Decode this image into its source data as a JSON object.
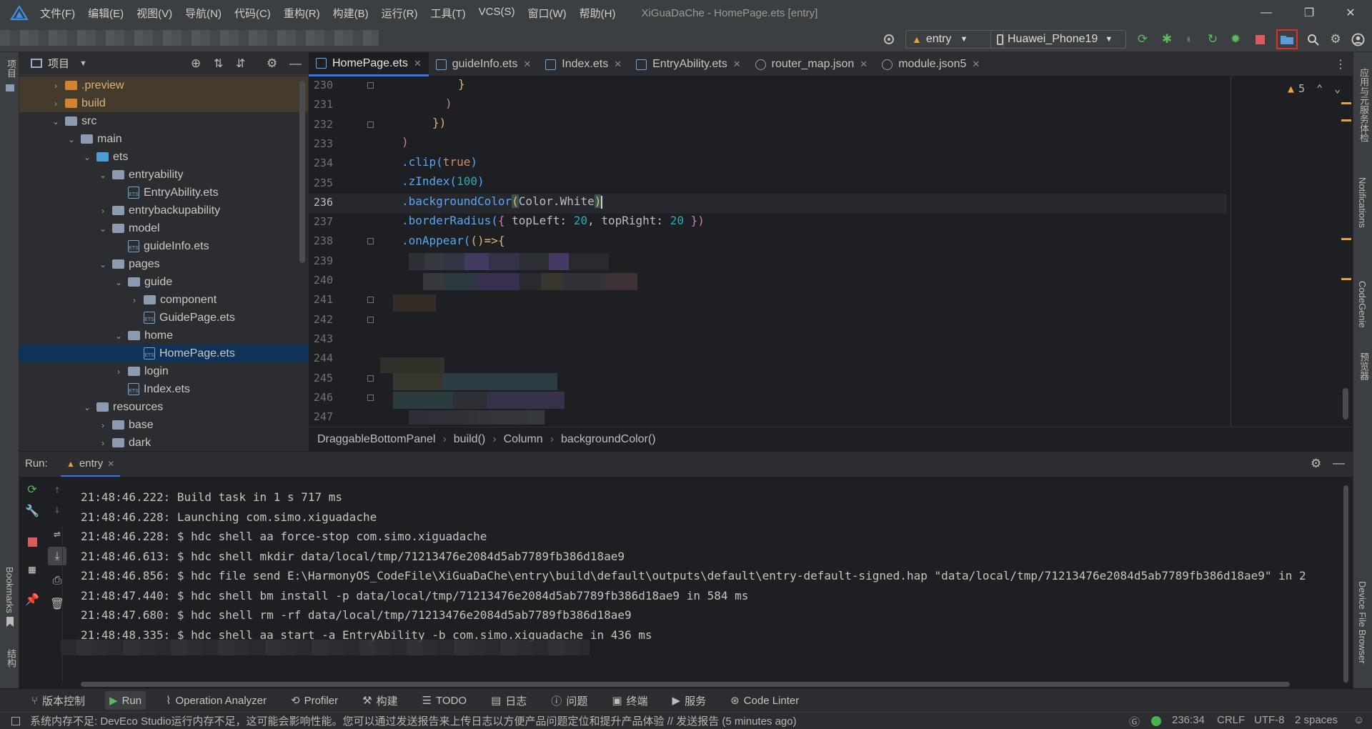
{
  "titlebar": {
    "menus": [
      "文件(F)",
      "编辑(E)",
      "视图(V)",
      "导航(N)",
      "代码(C)",
      "重构(R)",
      "构建(B)",
      "运行(R)",
      "工具(T)",
      "VCS(S)",
      "窗口(W)",
      "帮助(H)"
    ],
    "title": "XiGuaDaChe - HomePage.ets [entry]"
  },
  "toolbar": {
    "module": "entry",
    "device": "Huawei_Phone19"
  },
  "left_strip": {
    "project_label": "项目",
    "bookmarks_label": "Bookmarks",
    "structure_label": "结构"
  },
  "right_strip": {
    "item1": "应用与元服务体检",
    "item2": "Notifications",
    "item3": "CodeGenie",
    "item4": "预览器",
    "item5": "Device File Browser"
  },
  "project": {
    "title": "项目",
    "tree": [
      {
        "label": ".preview",
        "indent": 1,
        "chev": "›",
        "kind": "folder-orange",
        "excluded": true
      },
      {
        "label": "build",
        "indent": 1,
        "chev": "›",
        "kind": "folder-orange",
        "excluded": true
      },
      {
        "label": "src",
        "indent": 1,
        "chev": "⌄",
        "kind": "folder"
      },
      {
        "label": "main",
        "indent": 2,
        "chev": "⌄",
        "kind": "folder"
      },
      {
        "label": "ets",
        "indent": 3,
        "chev": "⌄",
        "kind": "folder-blue"
      },
      {
        "label": "entryability",
        "indent": 4,
        "chev": "⌄",
        "kind": "folder"
      },
      {
        "label": "EntryAbility.ets",
        "indent": 5,
        "chev": "",
        "kind": "file"
      },
      {
        "label": "entrybackupability",
        "indent": 4,
        "chev": "›",
        "kind": "folder"
      },
      {
        "label": "model",
        "indent": 4,
        "chev": "⌄",
        "kind": "folder"
      },
      {
        "label": "guideInfo.ets",
        "indent": 5,
        "chev": "",
        "kind": "file"
      },
      {
        "label": "pages",
        "indent": 4,
        "chev": "⌄",
        "kind": "folder"
      },
      {
        "label": "guide",
        "indent": 5,
        "chev": "⌄",
        "kind": "folder"
      },
      {
        "label": "component",
        "indent": 6,
        "chev": "›",
        "kind": "folder"
      },
      {
        "label": "GuidePage.ets",
        "indent": 6,
        "chev": "",
        "kind": "file"
      },
      {
        "label": "home",
        "indent": 5,
        "chev": "⌄",
        "kind": "folder"
      },
      {
        "label": "HomePage.ets",
        "indent": 6,
        "chev": "",
        "kind": "file",
        "selected": true
      },
      {
        "label": "login",
        "indent": 5,
        "chev": "›",
        "kind": "folder"
      },
      {
        "label": "Index.ets",
        "indent": 5,
        "chev": "",
        "kind": "file"
      },
      {
        "label": "resources",
        "indent": 3,
        "chev": "⌄",
        "kind": "folder"
      },
      {
        "label": "base",
        "indent": 4,
        "chev": "›",
        "kind": "folder"
      },
      {
        "label": "dark",
        "indent": 4,
        "chev": "›",
        "kind": "folder"
      }
    ]
  },
  "tabs": [
    {
      "label": "HomePage.ets",
      "active": true,
      "icon": "ets"
    },
    {
      "label": "guideInfo.ets",
      "icon": "ets"
    },
    {
      "label": "Index.ets",
      "icon": "ets"
    },
    {
      "label": "EntryAbility.ets",
      "icon": "ets"
    },
    {
      "label": "router_map.json",
      "icon": "json"
    },
    {
      "label": "module.json5",
      "icon": "json"
    }
  ],
  "editor": {
    "warnings": "5",
    "line_numbers": [
      "230",
      "231",
      "232",
      "233",
      "234",
      "235",
      "236",
      "237",
      "238",
      "239",
      "240",
      "241",
      "242",
      "243",
      "244",
      "245",
      "246",
      "247"
    ],
    "code": {
      "l230": "}",
      "l231": ")",
      "l232": "})",
      "l233": ")",
      "l234_a": ".clip(",
      "l234_b": "true",
      "l234_c": ")",
      "l235_a": ".zIndex(",
      "l235_b": "100",
      "l235_c": ")",
      "l236_a": ".backgroundColor",
      "l236_b": "(",
      "l236_c": "Color.White",
      "l236_d": ")",
      "l237_a": ".borderRadius(",
      "l237_b": "{ ",
      "l237_c": "topLeft: ",
      "l237_d": "20",
      "l237_e": ", topRight: ",
      "l237_f": "20",
      "l237_g": " })",
      "l238_a": ".onAppear(",
      "l238_b": "()=>{"
    }
  },
  "breadcrumb": [
    "DraggableBottomPanel",
    "build()",
    "Column",
    "backgroundColor()"
  ],
  "run": {
    "label": "Run:",
    "config": "entry",
    "logs": [
      "21:48:46.222: Build task in 1 s 717 ms",
      "21:48:46.228: Launching com.simo.xiguadache",
      "21:48:46.228: $ hdc shell aa force-stop com.simo.xiguadache",
      "21:48:46.613: $ hdc shell mkdir data/local/tmp/71213476e2084d5ab7789fb386d18ae9",
      "21:48:46.856: $ hdc file send E:\\HarmonyOS_CodeFile\\XiGuaDaChe\\entry\\build\\default\\outputs\\default\\entry-default-signed.hap \"data/local/tmp/71213476e2084d5ab7789fb386d18ae9\" in 2",
      "21:48:47.440: $ hdc shell bm install -p data/local/tmp/71213476e2084d5ab7789fb386d18ae9 in 584 ms",
      "21:48:47.680: $ hdc shell rm -rf data/local/tmp/71213476e2084d5ab7789fb386d18ae9",
      "21:48:48.335: $ hdc shell aa start -a EntryAbility -b com.simo.xiguadache in 436 ms"
    ]
  },
  "bottom_tabs": [
    "版本控制",
    "Run",
    "Operation Analyzer",
    "Profiler",
    "构建",
    "TODO",
    "日志",
    "问题",
    "终端",
    "服务",
    "Code Linter"
  ],
  "status": {
    "message": "系统内存不足: DevEco Studio运行内存不足，这可能会影响性能。您可以通过发送报告来上传日志以方便产品问题定位和提升产品体验 // 发送报告 (5 minutes ago)",
    "position": "236:34",
    "line_sep": "CRLF",
    "encoding": "UTF-8",
    "indent": "2 spaces"
  }
}
